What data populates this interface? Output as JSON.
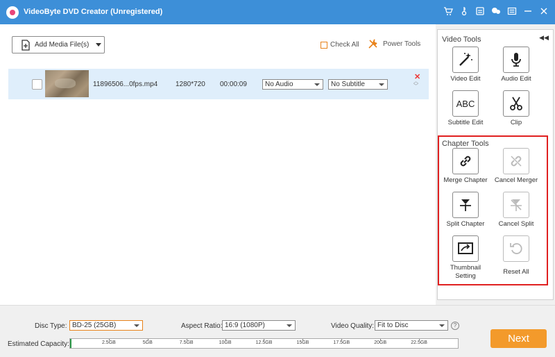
{
  "window": {
    "title": "VideoByte DVD Creator (Unregistered)",
    "icons": [
      "cart-icon",
      "key-icon",
      "file-icon",
      "chat-icon",
      "menu-icon",
      "minimize-icon",
      "close-icon"
    ]
  },
  "toolbar": {
    "add_media_label": "Add Media File(s)",
    "check_all_label": "Check All",
    "power_tools_label": "Power Tools"
  },
  "file_list": [
    {
      "name": "11896506...0fps.mp4",
      "resolution": "1280*720",
      "duration": "00:00:09",
      "audio": "No Audio",
      "subtitle": "No Subtitle"
    }
  ],
  "video_tools": {
    "title": "Video Tools",
    "items": [
      {
        "label": "Video Edit",
        "icon": "magic-wand-icon"
      },
      {
        "label": "Audio Edit",
        "icon": "microphone-icon"
      },
      {
        "label": "Subtitle Edit",
        "icon": "abc-text-icon",
        "glyph": "ABC"
      },
      {
        "label": "Clip",
        "icon": "scissors-icon"
      }
    ]
  },
  "chapter_tools": {
    "title": "Chapter Tools",
    "items": [
      {
        "label": "Merge Chapter",
        "icon": "link-icon"
      },
      {
        "label": "Cancel Merger",
        "icon": "broken-link-icon"
      },
      {
        "label": "Split Chapter",
        "icon": "split-icon"
      },
      {
        "label": "Cancel Split",
        "icon": "cancel-split-icon"
      },
      {
        "label": "Thumbnail Setting",
        "icon": "thumbnail-icon"
      },
      {
        "label": "Reset All",
        "icon": "reset-icon"
      }
    ]
  },
  "bottom": {
    "disc_type_label": "Disc Type:",
    "disc_type_value": "BD-25 (25GB)",
    "aspect_ratio_label": "Aspect Ratio:",
    "aspect_ratio_value": "16:9 (1080P)",
    "video_quality_label": "Video Quality:",
    "video_quality_value": "Fit to Disc",
    "help_glyph": "?",
    "estimated_capacity_label": "Estimated Capacity:",
    "capacity_ticks": [
      "2.5GB",
      "5GB",
      "7.5GB",
      "10GB",
      "12.5GB",
      "15GB",
      "17.5GB",
      "20GB",
      "22.5GB"
    ],
    "next_label": "Next"
  },
  "colors": {
    "titlebar": "#3d8fd8",
    "accent": "#f39a2b",
    "highlight_box": "#e02020",
    "selected_row": "#dfeefb"
  }
}
